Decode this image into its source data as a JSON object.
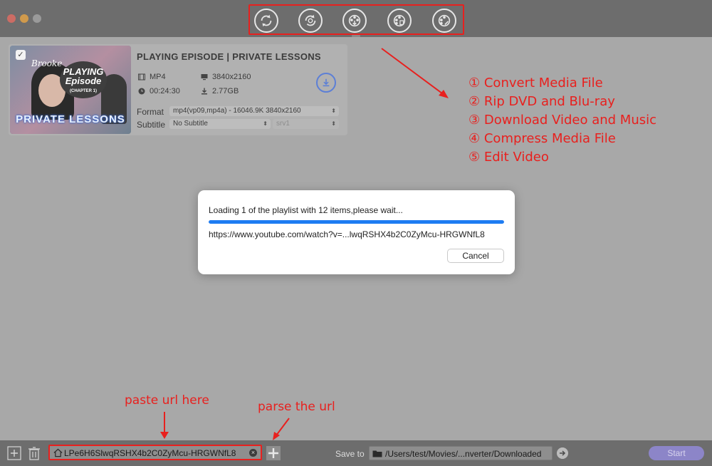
{
  "toolbar": {
    "tools": [
      {
        "name": "convert-media-icon"
      },
      {
        "name": "rip-dvd-icon"
      },
      {
        "name": "download-video-icon"
      },
      {
        "name": "compress-media-icon"
      },
      {
        "name": "edit-video-icon"
      }
    ]
  },
  "media_card": {
    "thumbnail_brand": "Brooke",
    "thumbnail_badge_line1": "PLAYING",
    "thumbnail_badge_line2": "Episode",
    "thumbnail_badge_line3": "(CHAPTER 1)",
    "thumbnail_title": "PRIVATE LESSONS",
    "title": "PLAYING EPISODE | PRIVATE LESSONS",
    "container": "MP4",
    "resolution": "3840x2160",
    "duration": "00:24:30",
    "size": "2.77GB",
    "format_label": "Format",
    "format_value": "mp4(vp09,mp4a) - 16046.9K 3840x2160",
    "subtitle_label": "Subtitle",
    "subtitle_value": "No Subtitle",
    "subtitle_track": "srv1"
  },
  "annotations": {
    "legend": [
      "① Convert Media File",
      "② Rip DVD and Blu-ray",
      "③ Download Video and Music",
      "④ Compress Media File",
      "⑤ Edit Video"
    ],
    "paste_hint": "paste url here",
    "parse_hint": "parse the url"
  },
  "dialog": {
    "message": "Loading 1 of the playlist with 12 items,please wait...",
    "progress_percent": 100,
    "url": "https://www.youtube.com/watch?v=...lwqRSHX4b2C0ZyMcu-HRGWNfL8",
    "cancel_label": "Cancel"
  },
  "bottom_bar": {
    "url_value": "LPe6H6SlwqRSHX4b2C0ZyMcu-HRGWNfL8",
    "save_to_label": "Save to",
    "save_path": "/Users/test/Movies/...nverter/Downloaded",
    "start_label": "Start"
  },
  "colors": {
    "annotation_red": "#e8201e",
    "progress_blue": "#1e7cf2",
    "start_button": "#8c85c8"
  }
}
